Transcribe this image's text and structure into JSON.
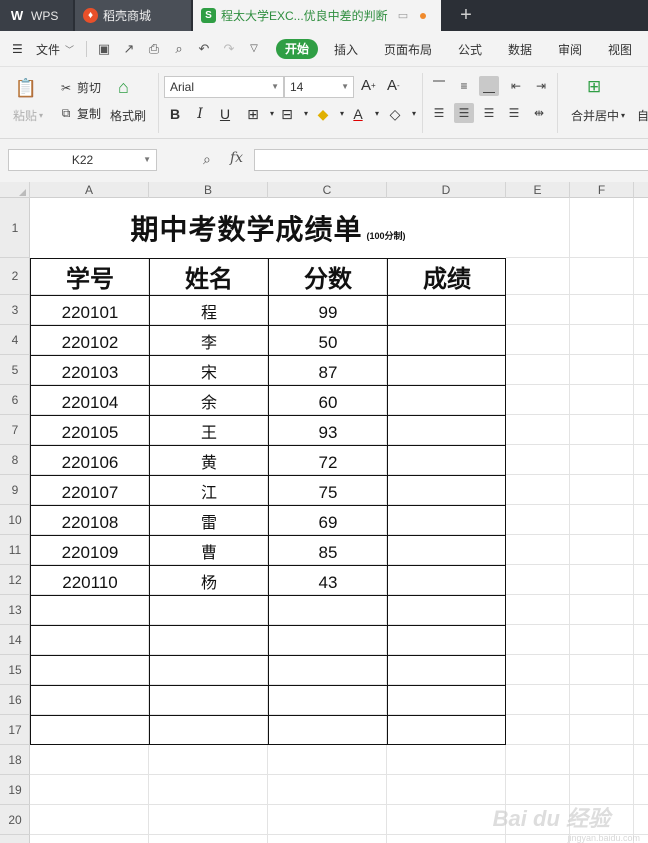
{
  "tabs": {
    "wps_label": "WPS",
    "store_label": "稻壳商城",
    "doc_label": "程太大学EXC...优良中差的判断"
  },
  "menu": {
    "file": "文件",
    "start": "开始",
    "insert": "插入",
    "page_layout": "页面布局",
    "formula": "公式",
    "data": "数据",
    "review": "审阅",
    "view": "视图"
  },
  "ribbon": {
    "paste": "粘贴",
    "cut": "剪切",
    "copy": "复制",
    "format_painter": "格式刷",
    "font_name": "Arial",
    "font_size": "14",
    "merge_center": "合并居中",
    "auto_wrap": "自"
  },
  "formula_bar": {
    "cell_ref": "K22",
    "fx": "fx",
    "value": ""
  },
  "columns": [
    "A",
    "B",
    "C",
    "D",
    "E",
    "F"
  ],
  "rows": [
    "1",
    "2",
    "3",
    "4",
    "5",
    "6",
    "7",
    "8",
    "9",
    "10",
    "11",
    "12",
    "13",
    "14",
    "15",
    "16",
    "17",
    "18",
    "19",
    "20"
  ],
  "sheet": {
    "title": "期中考数学成绩单",
    "title_note": "(100分制)",
    "headers": [
      "学号",
      "姓名",
      "分数",
      "成绩"
    ],
    "records": [
      [
        "220101",
        "程",
        "99",
        ""
      ],
      [
        "220102",
        "李",
        "50",
        ""
      ],
      [
        "220103",
        "宋",
        "87",
        ""
      ],
      [
        "220104",
        "余",
        "60",
        ""
      ],
      [
        "220105",
        "王",
        "93",
        ""
      ],
      [
        "220106",
        "黄",
        "72",
        ""
      ],
      [
        "220107",
        "江",
        "75",
        ""
      ],
      [
        "220108",
        "雷",
        "69",
        ""
      ],
      [
        "220109",
        "曹",
        "85",
        ""
      ],
      [
        "220110",
        "杨",
        "43",
        ""
      ]
    ]
  },
  "watermark": {
    "main": "Bai du 经验",
    "sub": "jingyan.baidu.com"
  },
  "colors": {
    "accent": "#2f9e44",
    "tabbar": "#2b2f36"
  }
}
